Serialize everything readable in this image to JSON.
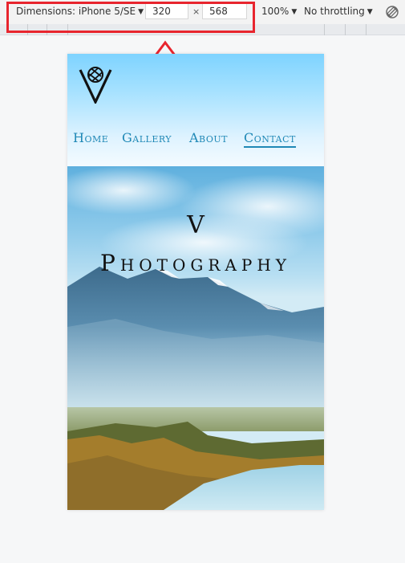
{
  "toolbar": {
    "dimensions_label": "Dimensions: iPhone 5/SE",
    "caret": "▼",
    "width_value": "320",
    "height_value": "568",
    "times": "×",
    "zoom_label": "100%",
    "throttle_label": "No throttling",
    "rotate_icon": "rotate-icon"
  },
  "colors": {
    "highlight": "#e8252e",
    "nav_link": "#1f88b6",
    "header_sky": "#7ed3ff"
  },
  "site": {
    "logo_icon": "camera-shutter-v-logo",
    "nav": [
      {
        "label": "Home"
      },
      {
        "label": "Gallery"
      },
      {
        "label": "About"
      },
      {
        "label": "Contact"
      }
    ],
    "active_nav": "Contact",
    "hero": {
      "title_letter": "V",
      "title_word": "Photography"
    }
  }
}
